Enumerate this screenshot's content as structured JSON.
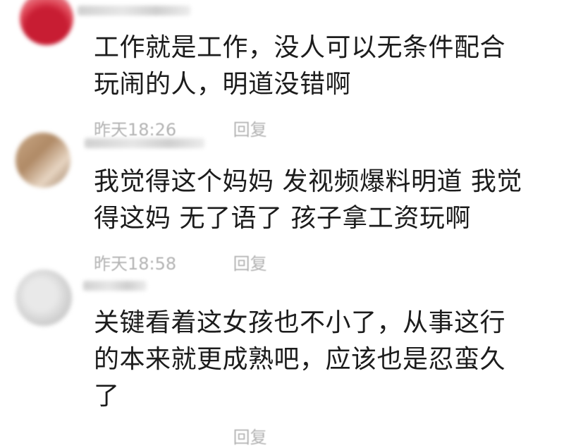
{
  "comments": [
    {
      "text_lines": [
        "工作就是工作，没人可以无条件配合",
        "玩闹的人，明道没错啊"
      ],
      "time": "昨天18:26",
      "reply_label": "回复"
    },
    {
      "text_lines": [
        "我觉得这个妈妈 发视频爆料明道 我觉",
        "得这妈 无了语了 孩子拿工资玩啊"
      ],
      "time": "昨天18:58",
      "reply_label": "回复"
    },
    {
      "text_lines": [
        "关键看着这女孩也不小了，从事这行",
        "的本来就更成熟吧，应该也是忍蛮久",
        "了"
      ],
      "time": "",
      "reply_label": "回复"
    }
  ]
}
